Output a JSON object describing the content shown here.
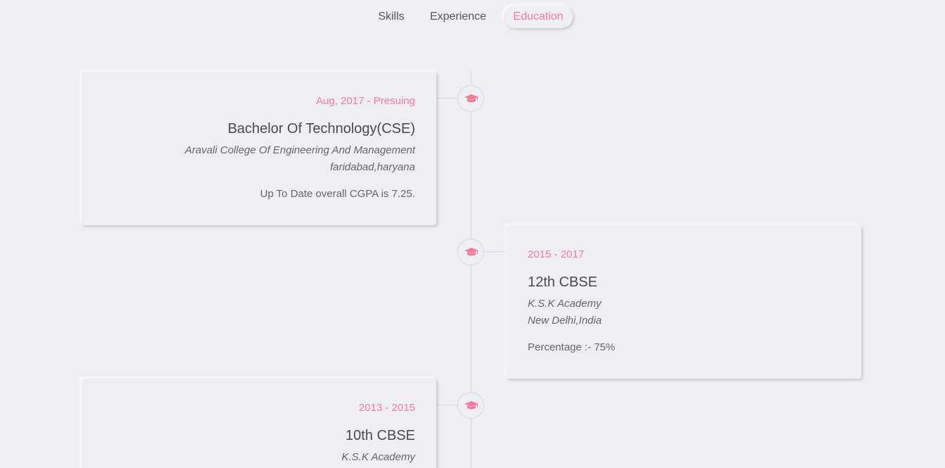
{
  "tabs": {
    "skills": "Skills",
    "experience": "Experience",
    "education": "Education"
  },
  "accent_color": "#f27a9c",
  "education": [
    {
      "date": "Aug, 2017 - Presuing",
      "title": "Bachelor Of Technology(CSE)",
      "school_line1": "Aravali College Of Engineering And Management",
      "school_line2": "faridabad,haryana",
      "description": "Up To Date overall CGPA is 7.25.",
      "icon": "graduation-cap-icon"
    },
    {
      "date": "2015 - 2017",
      "title": "12th CBSE",
      "school_line1": "K.S.K Academy",
      "school_line2": "New Delhi,India",
      "description": "Percentage :- 75%",
      "icon": "graduation-cap-icon"
    },
    {
      "date": "2013 - 2015",
      "title": "10th CBSE",
      "school_line1": "K.S.K Academy",
      "icon": "graduation-cap-icon"
    }
  ]
}
